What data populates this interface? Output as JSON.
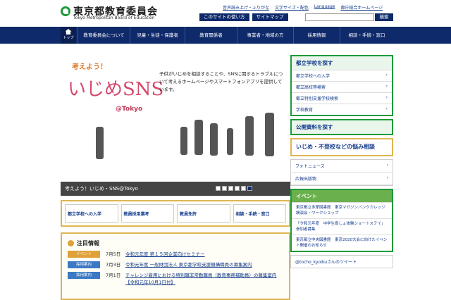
{
  "header": {
    "org_ja": "東京都教育委員会",
    "org_en": "Tokyo Metropolitan Board of Education",
    "util_links": [
      "音声読み上げ・ふりがな",
      "文字サイズ・配色",
      "Language",
      "都庁総合ホームページ"
    ],
    "btn_usage": "このサイトの使い方",
    "btn_sitemap": "サイトマップ",
    "search_button": "検索"
  },
  "nav": {
    "home": "トップ",
    "items": [
      "教育委員会について",
      "児童・生徒・保護者",
      "教育関係者",
      "事業者・地域の方",
      "採用情報",
      "相談・手続・窓口"
    ]
  },
  "hero": {
    "kicker": "考えよう！",
    "title": "いじめSNS",
    "sub": "@Tokyo",
    "text": "子供がいじめを相談することや、SNSに関するトラブルについて考えるホームページやスマートフォンアプリを提供しています。",
    "caption": "考えよう！いじめ・SNS@Tokyo"
  },
  "quick": [
    "都立学校への入学",
    "教員採用選考",
    "教員免許",
    "相談・手続・窓口"
  ],
  "news": {
    "heading": "注目情報",
    "items": [
      {
        "tag": "イベント",
        "tag_color": "#e0a03a",
        "date": "7月5日",
        "text": "令和元年度 第１５回企業向けセミナー"
      },
      {
        "tag": "採用案内",
        "tag_color": "#3c79c4",
        "date": "7月3日",
        "text": "令和元年度 一般財団法人 東京都学校支援機構職員の募集案内"
      },
      {
        "tag": "採用案内",
        "tag_color": "#3c79c4",
        "date": "7月1日",
        "text": "チャレンジ雇用における特別職非常勤職員（教育事務補助員）の募集案内【令和元年10月1日付】"
      }
    ]
  },
  "side": {
    "school_head": "都立学校を探す",
    "school_items": [
      "都立学校への入学",
      "都立高校等検索",
      "都立特別支援学校検索",
      "学校教育"
    ],
    "public_docs": "公開資料を探す",
    "ijime": "いじめ・不登校などの悩み相談",
    "photo_news": "フォトニュース",
    "pr": "広報出版物",
    "event_head": "イベント",
    "events": [
      "東京都立多摩図書館　東京マガジンバンクカレッジ　講演会・ワークショップ",
      "「令和元年度　中学生島しょ体験ショートステイ」参加者募集",
      "東京都立中央図書館　東京2020大会に向けたイベント開催のお知らせ"
    ],
    "tweet_account": "@tocho_kyoiku",
    "tweet_suffix": "さんのツイート"
  }
}
